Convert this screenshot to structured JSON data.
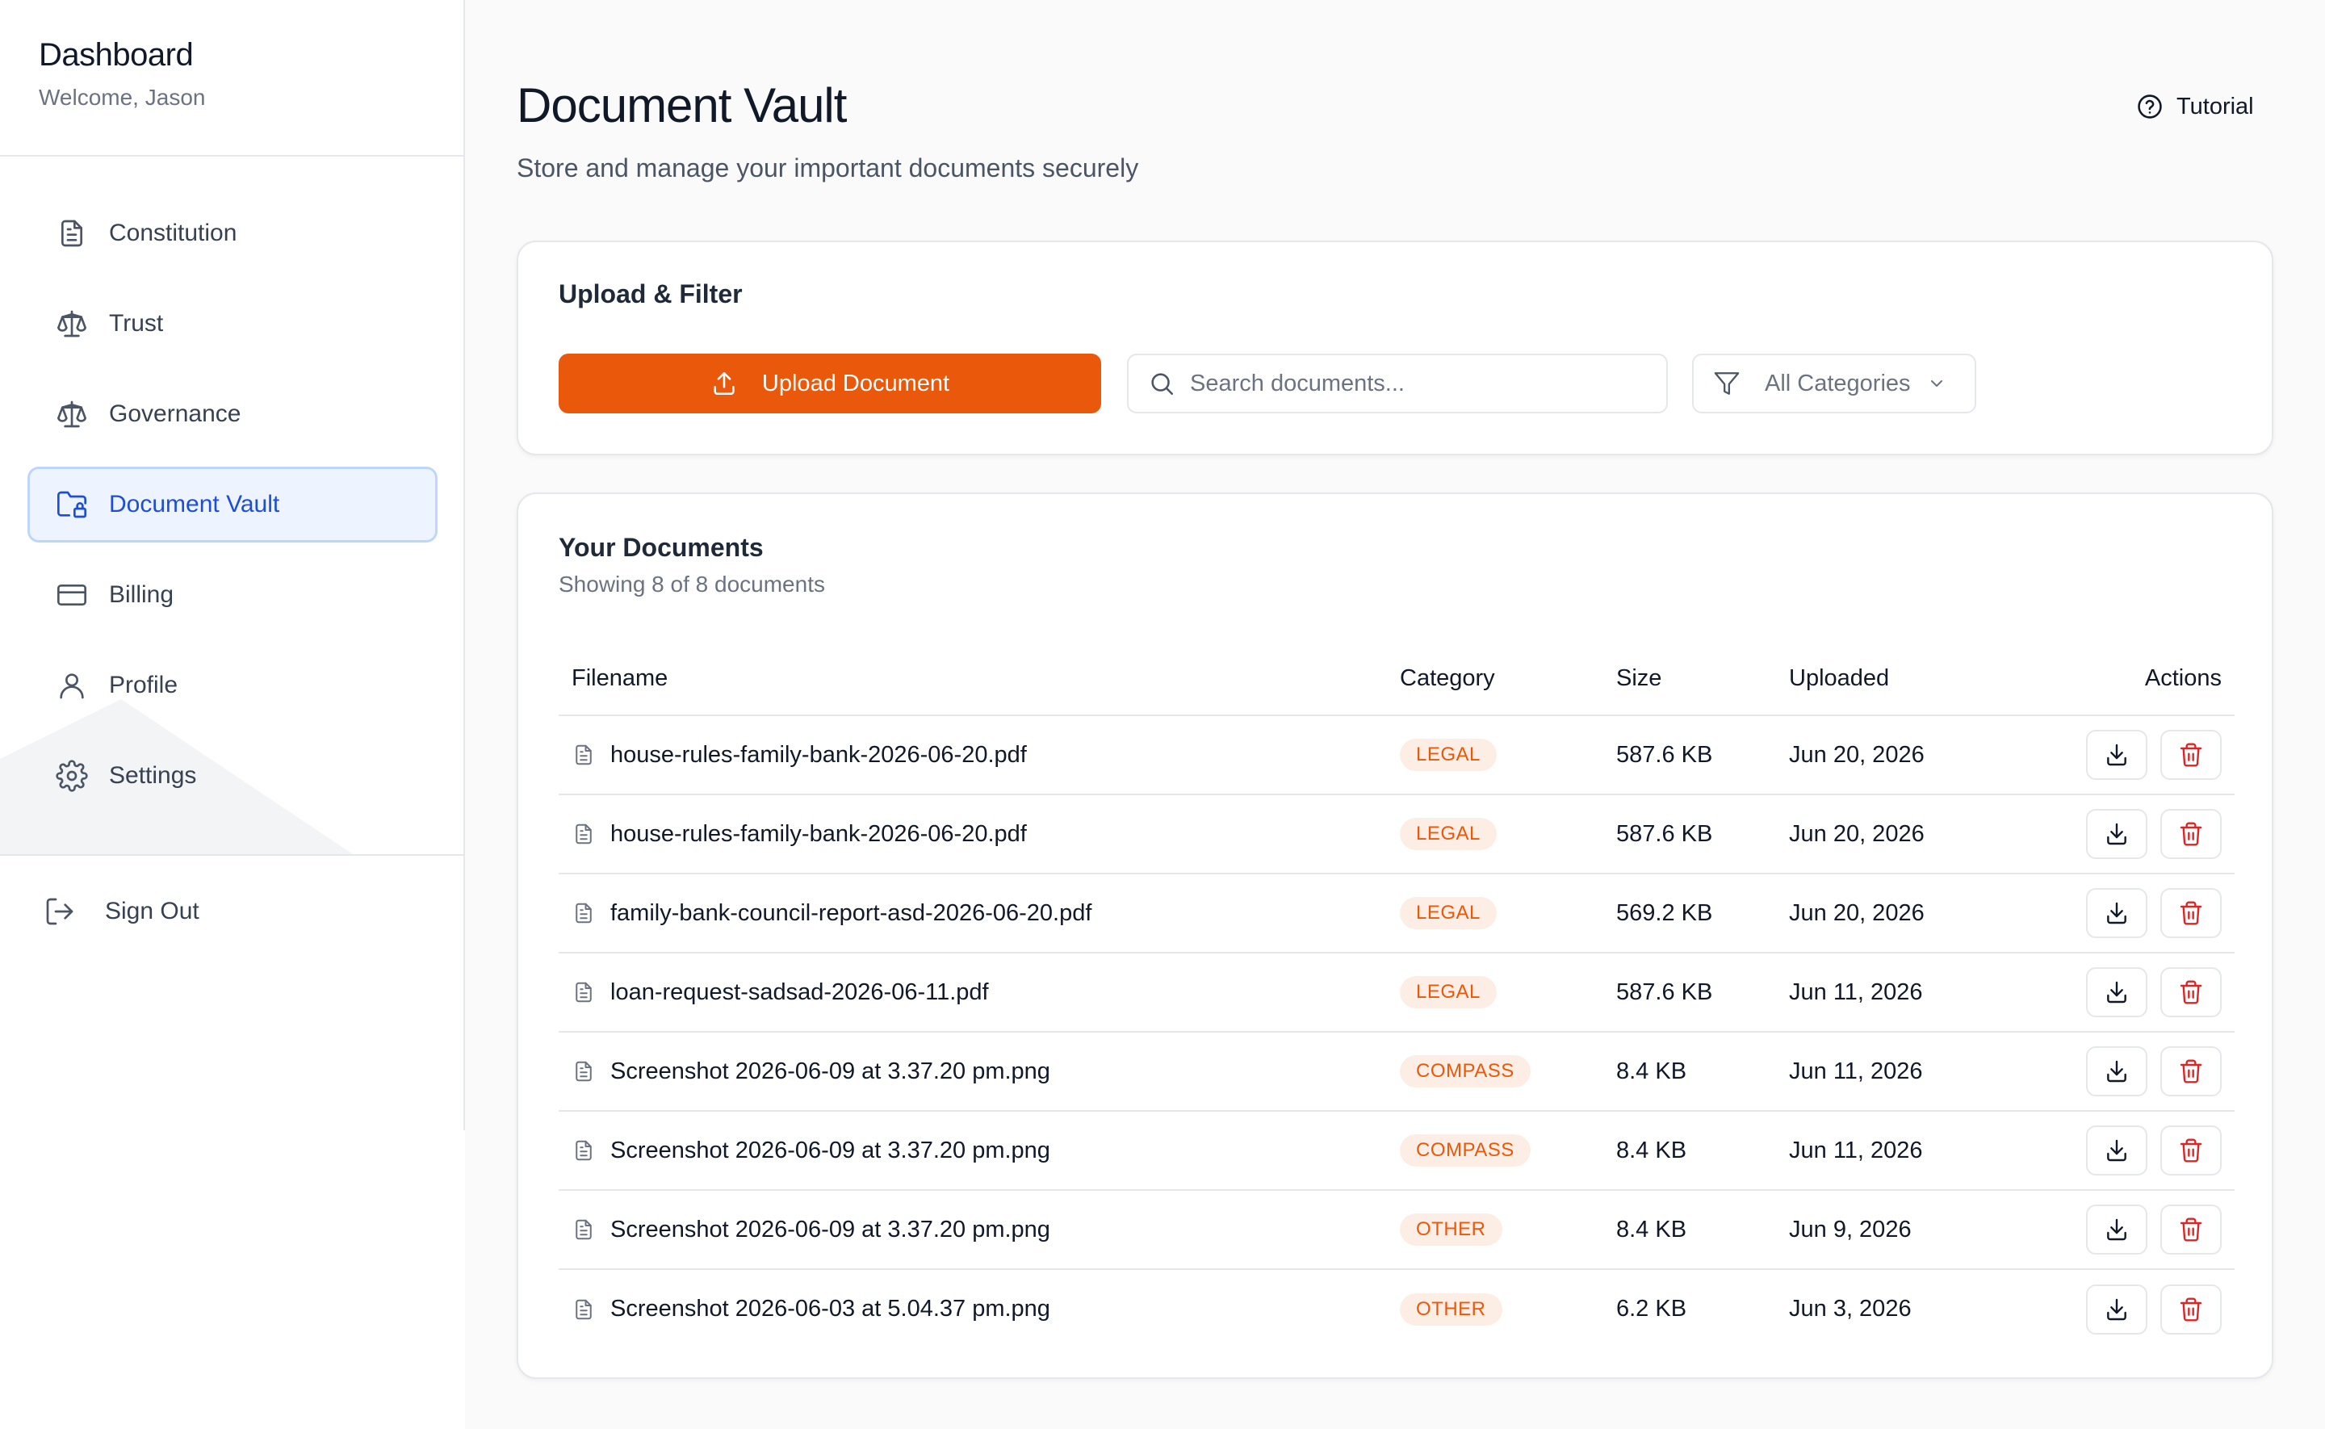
{
  "sidebar": {
    "title": "Dashboard",
    "subtitle": "Welcome, Jason",
    "items": [
      {
        "label": "Constitution",
        "icon": "file-text-icon"
      },
      {
        "label": "Trust",
        "icon": "scale-icon"
      },
      {
        "label": "Governance",
        "icon": "scale-icon"
      },
      {
        "label": "Document Vault",
        "icon": "folder-lock-icon",
        "active": true
      },
      {
        "label": "Billing",
        "icon": "credit-card-icon"
      },
      {
        "label": "Profile",
        "icon": "user-icon"
      },
      {
        "label": "Settings",
        "icon": "gear-icon"
      }
    ],
    "signout_label": "Sign Out"
  },
  "header": {
    "title": "Document Vault",
    "subtitle": "Store and manage your important documents securely",
    "tutorial_label": "Tutorial"
  },
  "upload_filter": {
    "title": "Upload & Filter",
    "upload_label": "Upload Document",
    "search_placeholder": "Search documents...",
    "category_selected": "All Categories"
  },
  "documents": {
    "title": "Your Documents",
    "subtitle": "Showing 8 of 8 documents",
    "columns": {
      "filename": "Filename",
      "category": "Category",
      "size": "Size",
      "uploaded": "Uploaded",
      "actions": "Actions"
    },
    "rows": [
      {
        "filename": "house-rules-family-bank-2026-06-20.pdf",
        "category": "LEGAL",
        "size": "587.6 KB",
        "uploaded": "Jun 20, 2026"
      },
      {
        "filename": "house-rules-family-bank-2026-06-20.pdf",
        "category": "LEGAL",
        "size": "587.6 KB",
        "uploaded": "Jun 20, 2026"
      },
      {
        "filename": "family-bank-council-report-asd-2026-06-20.pdf",
        "category": "LEGAL",
        "size": "569.2 KB",
        "uploaded": "Jun 20, 2026"
      },
      {
        "filename": "loan-request-sadsad-2026-06-11.pdf",
        "category": "LEGAL",
        "size": "587.6 KB",
        "uploaded": "Jun 11, 2026"
      },
      {
        "filename": "Screenshot 2026-06-09 at 3.37.20 pm.png",
        "category": "COMPASS",
        "size": "8.4 KB",
        "uploaded": "Jun 11, 2026"
      },
      {
        "filename": "Screenshot 2026-06-09 at 3.37.20 pm.png",
        "category": "COMPASS",
        "size": "8.4 KB",
        "uploaded": "Jun 11, 2026"
      },
      {
        "filename": "Screenshot 2026-06-09 at 3.37.20 pm.png",
        "category": "OTHER",
        "size": "8.4 KB",
        "uploaded": "Jun 9, 2026"
      },
      {
        "filename": "Screenshot 2026-06-03 at 5.04.37 pm.png",
        "category": "OTHER",
        "size": "6.2 KB",
        "uploaded": "Jun 3, 2026"
      }
    ]
  },
  "colors": {
    "accent": "#ea580c",
    "active_nav_bg": "#eef4ff",
    "active_nav_text": "#1d4ed8",
    "danger": "#dc2626"
  }
}
